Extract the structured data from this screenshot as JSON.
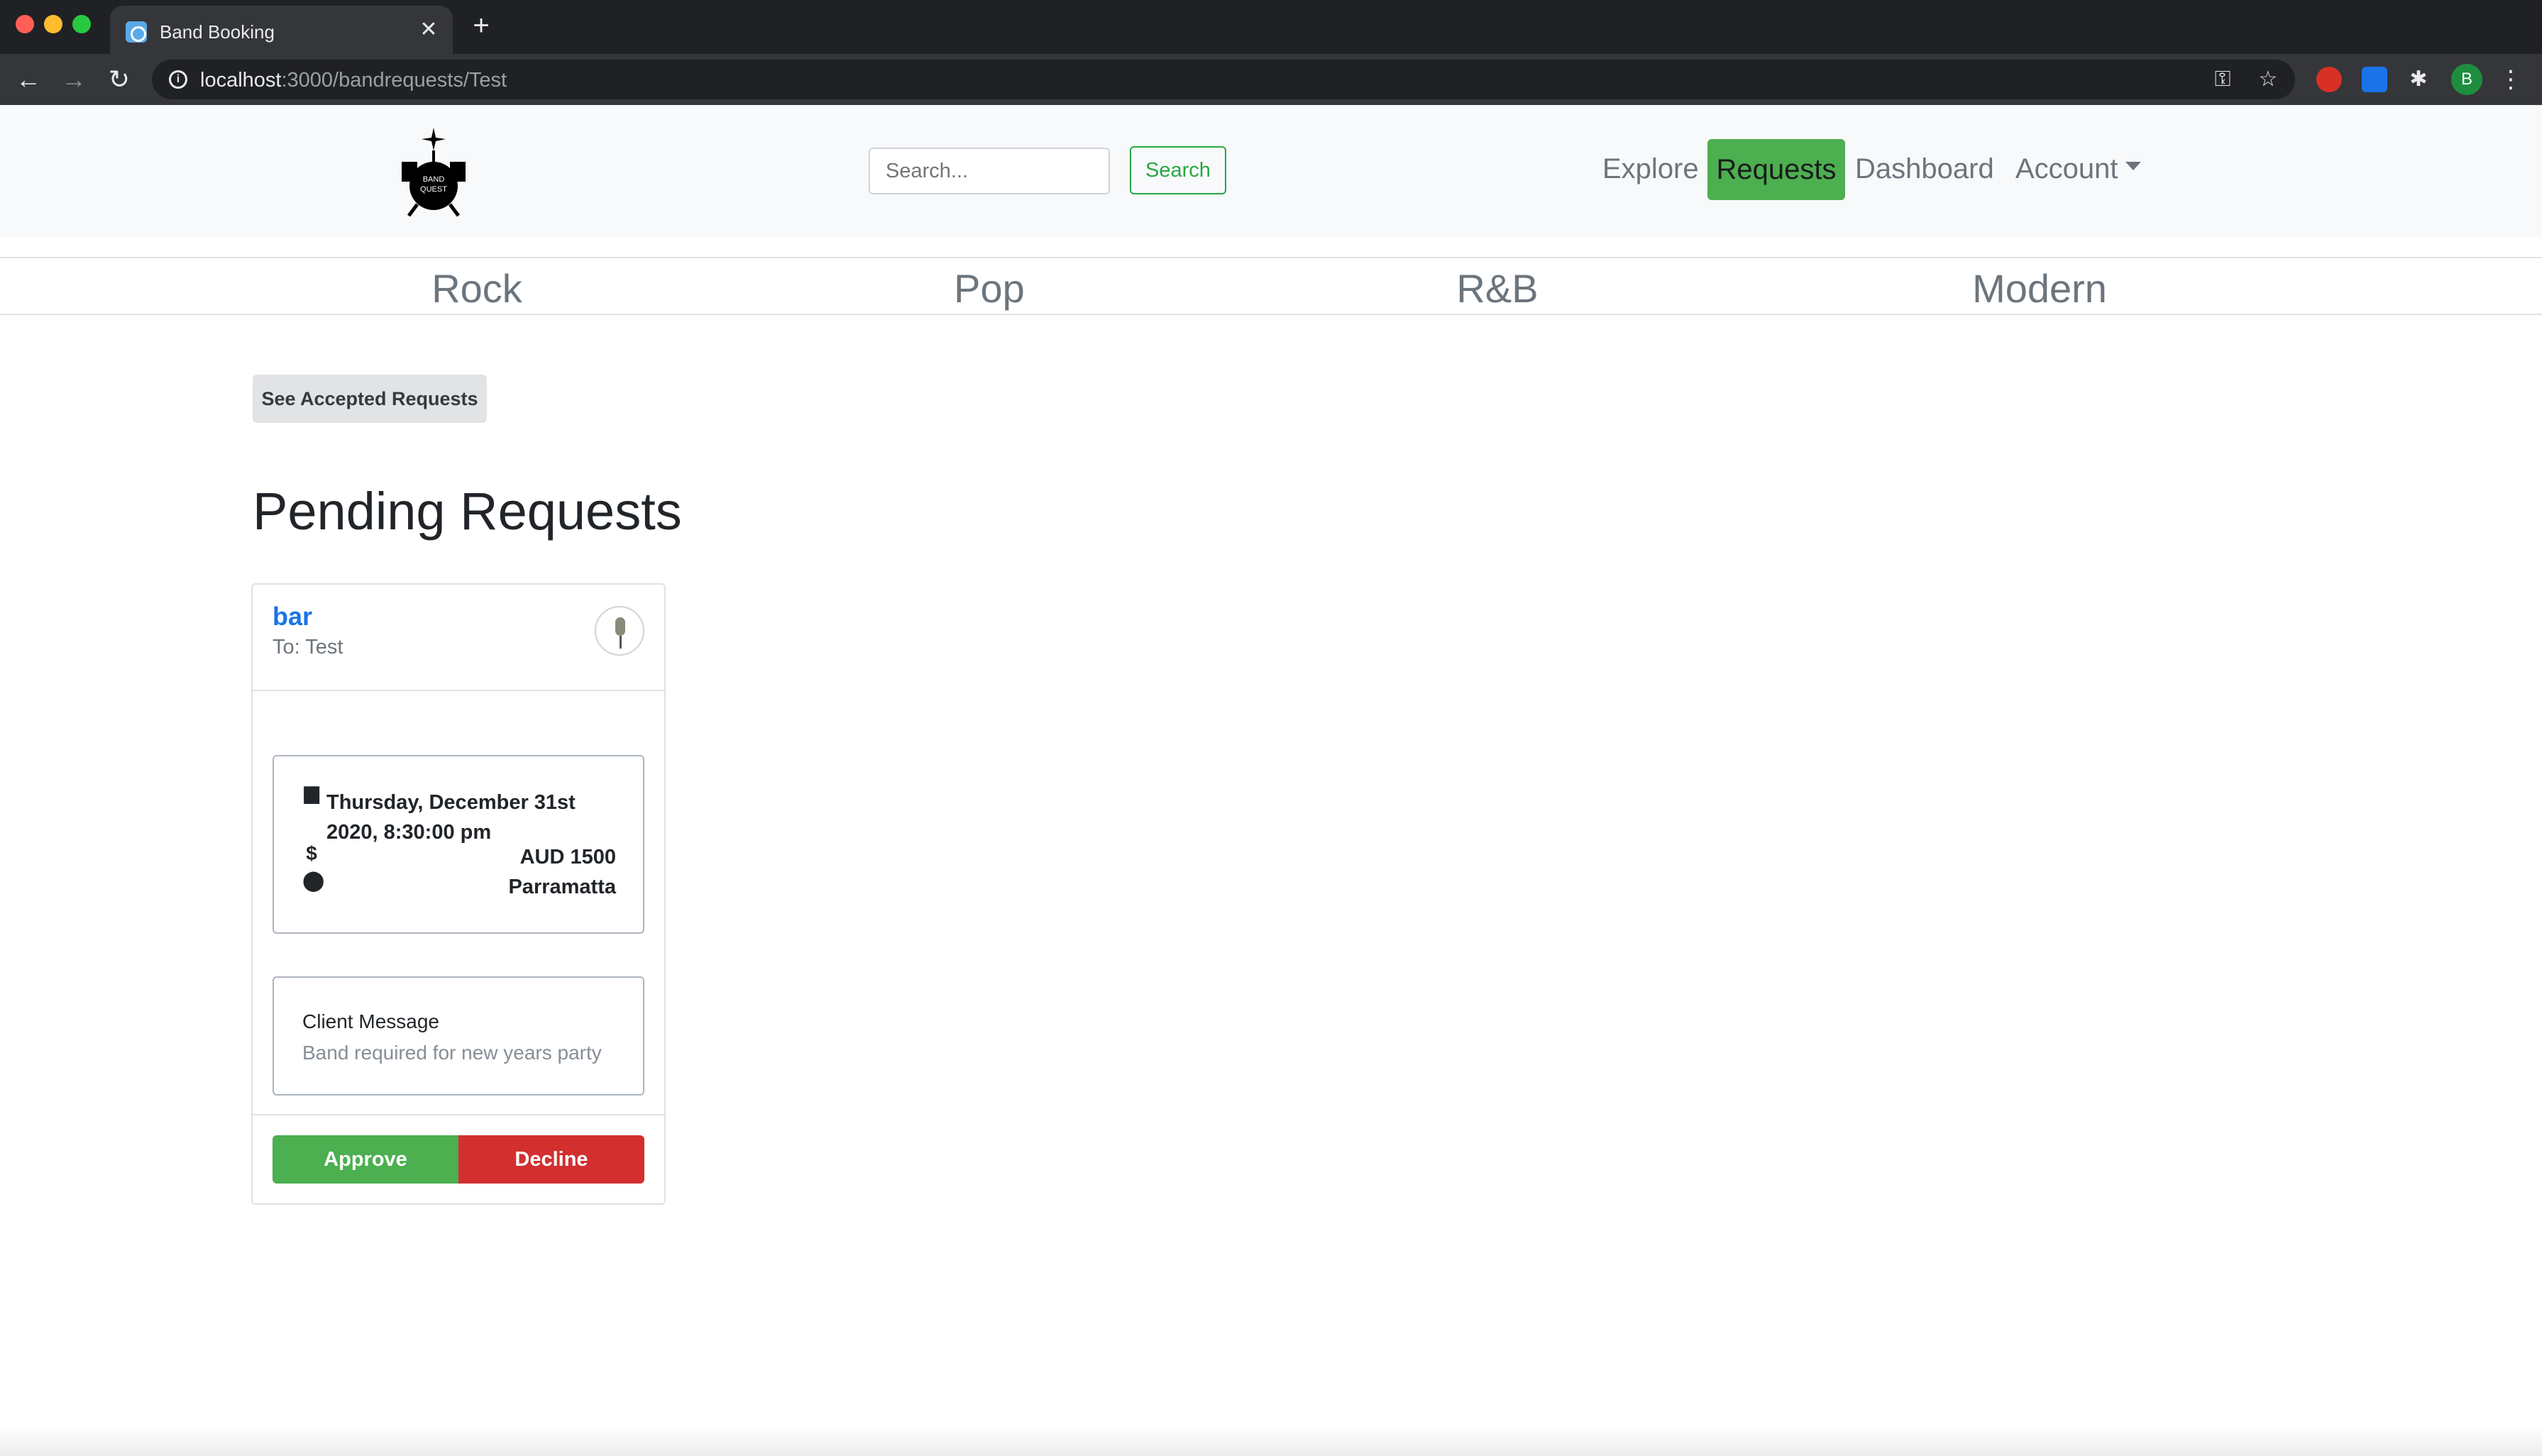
{
  "browser": {
    "tab_title": "Band Booking",
    "tab_close": "✕",
    "new_tab": "+",
    "url_host": "localhost",
    "url_path": ":3000/bandrequests/Test",
    "profile_initial": "B"
  },
  "navbar": {
    "logo_alt": "Band Quest logo",
    "search_placeholder": "Search...",
    "search_button": "Search",
    "links": {
      "explore": "Explore",
      "requests": "Requests",
      "dashboard": "Dashboard",
      "account": "Account"
    },
    "active_link": "Requests",
    "accent_color": "#4caf50"
  },
  "genres": [
    "Rock",
    "Pop",
    "R&B",
    "Modern"
  ],
  "main": {
    "accepted_button": "See Accepted Requests",
    "title": "Pending Requests"
  },
  "requests": [
    {
      "venue": "bar",
      "to": "To: Test",
      "date": "Thursday, December 31st 2020, 8:30:00 pm",
      "price": "AUD 1500",
      "location": "Parramatta",
      "message_label": "Client Message",
      "message": "Band required for new years party",
      "approve_label": "Approve",
      "decline_label": "Decline"
    }
  ],
  "colors": {
    "approve": "#4caf50",
    "decline": "#d32f2f",
    "link": "#1a73e8"
  }
}
